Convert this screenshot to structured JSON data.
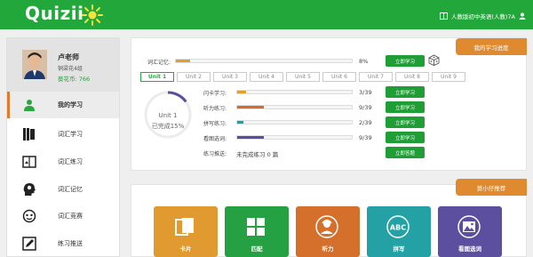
{
  "app": {
    "logo": "Quizii",
    "textbook_label": "人教版初中英语(人教)7A"
  },
  "profile": {
    "name": "卢老师",
    "class": "铜梁花4组",
    "flowers": "葵花币: 766"
  },
  "sidebar": {
    "items": [
      {
        "label": "我的学习",
        "icon": "student-icon",
        "active": true
      },
      {
        "label": "词汇学习",
        "icon": "book-icon"
      },
      {
        "label": "词汇练习",
        "icon": "practice-book-icon"
      },
      {
        "label": "词汇记忆",
        "icon": "brain-head-icon"
      },
      {
        "label": "词汇竞赛",
        "icon": "competition-icon"
      },
      {
        "label": "练习推送",
        "icon": "pencil-icon"
      }
    ]
  },
  "progress_panel": {
    "ribbon": "我的学习进度",
    "vocab_memory": {
      "label": "词汇记忆:",
      "percent_text": "8%",
      "fraction": 0.08,
      "button": "立即学习"
    },
    "unit_tabs": [
      "Unit 1",
      "Unit 2",
      "Unit 3",
      "Unit 4",
      "Unit 5",
      "Unit 6",
      "Unit 7",
      "Unit 8",
      "Unit 9"
    ],
    "active_unit": 0,
    "ring": {
      "title": "Unit 1",
      "subtitle": "已完成15%",
      "fraction": 0.15
    },
    "rows": [
      {
        "label": "闪卡学习:",
        "value": "3/39",
        "fraction": 0.077,
        "color": "#e0a030",
        "button": "立即学习"
      },
      {
        "label": "听力练习:",
        "value": "9/39",
        "fraction": 0.231,
        "color": "#d66a2a",
        "button": "立即学习"
      },
      {
        "label": "拼写练习:",
        "value": "2/39",
        "fraction": 0.051,
        "color": "#2a9aa0",
        "button": "立即学习"
      },
      {
        "label": "看图选词:",
        "value": "9/39",
        "fraction": 0.231,
        "color": "#5a4f9e",
        "button": "立即学习"
      }
    ],
    "push": {
      "label": "练习推送:",
      "value": "未完成练习 0 篇",
      "button": "立即答题"
    }
  },
  "recommend_panel": {
    "ribbon": "葵小仔推荐",
    "tiles": [
      {
        "label": "卡片",
        "color": "#e19a30",
        "icon": "flashcard-icon"
      },
      {
        "label": "匹配",
        "color": "#25a043",
        "icon": "grid-match-icon"
      },
      {
        "label": "听力",
        "color": "#d4702c",
        "icon": "listening-person-icon"
      },
      {
        "label": "拼写",
        "color": "#23a1a4",
        "icon": "abc-icon"
      },
      {
        "label": "看图选词",
        "color": "#5c4f9f",
        "icon": "picture-icon"
      }
    ]
  }
}
